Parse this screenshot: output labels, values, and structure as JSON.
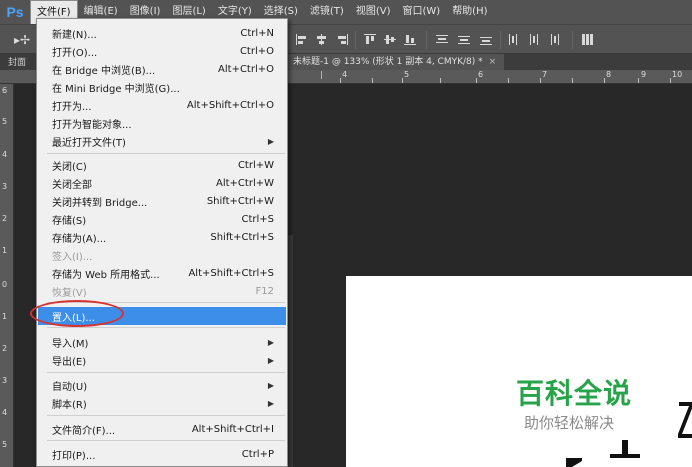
{
  "menubar": {
    "logo": "Ps",
    "items": [
      "文件(F)",
      "编辑(E)",
      "图像(I)",
      "图层(L)",
      "文字(Y)",
      "选择(S)",
      "滤镜(T)",
      "视图(V)",
      "窗口(W)",
      "帮助(H)"
    ]
  },
  "tabs": {
    "left_label": "封面",
    "document": "未标题-1 @ 133% (形状 1 副本 4, CMYK/8) *",
    "close": "×"
  },
  "ruler": {
    "top": [
      "4",
      "5",
      "6",
      "7",
      "8",
      "9",
      "10"
    ],
    "left": [
      "6",
      "5",
      "4",
      "3",
      "2",
      "1",
      "0",
      "1",
      "2",
      "3",
      "4",
      "5"
    ]
  },
  "file_menu": {
    "items": [
      {
        "label": "新建(N)...",
        "shortcut": "Ctrl+N"
      },
      {
        "label": "打开(O)...",
        "shortcut": "Ctrl+O"
      },
      {
        "label": "在 Bridge 中浏览(B)...",
        "shortcut": "Alt+Ctrl+O"
      },
      {
        "label": "在 Mini Bridge 中浏览(G)...",
        "shortcut": ""
      },
      {
        "label": "打开为...",
        "shortcut": "Alt+Shift+Ctrl+O"
      },
      {
        "label": "打开为智能对象...",
        "shortcut": ""
      },
      {
        "label": "最近打开文件(T)",
        "shortcut": ""
      },
      {
        "label": "关闭(C)",
        "shortcut": "Ctrl+W"
      },
      {
        "label": "关闭全部",
        "shortcut": "Alt+Ctrl+W"
      },
      {
        "label": "关闭并转到 Bridge...",
        "shortcut": "Shift+Ctrl+W"
      },
      {
        "label": "存储(S)",
        "shortcut": "Ctrl+S"
      },
      {
        "label": "存储为(A)...",
        "shortcut": "Shift+Ctrl+S"
      },
      {
        "label": "签入(I)...",
        "shortcut": ""
      },
      {
        "label": "存储为 Web 所用格式...",
        "shortcut": "Alt+Shift+Ctrl+S"
      },
      {
        "label": "恢复(V)",
        "shortcut": "F12"
      },
      {
        "label": "置入(L)...",
        "shortcut": ""
      },
      {
        "label": "导入(M)",
        "shortcut": ""
      },
      {
        "label": "导出(E)",
        "shortcut": ""
      },
      {
        "label": "自动(U)",
        "shortcut": ""
      },
      {
        "label": "脚本(R)",
        "shortcut": ""
      },
      {
        "label": "文件简介(F)...",
        "shortcut": "Alt+Shift+Ctrl+I"
      },
      {
        "label": "打印(P)...",
        "shortcut": "Ctrl+P"
      }
    ]
  },
  "watermark": {
    "title": "百科全说",
    "subtitle": "助你轻松解决"
  },
  "colors": {
    "highlight": "#3d8ee8",
    "annotation": "#d63333",
    "watermark": "#27a44a"
  }
}
